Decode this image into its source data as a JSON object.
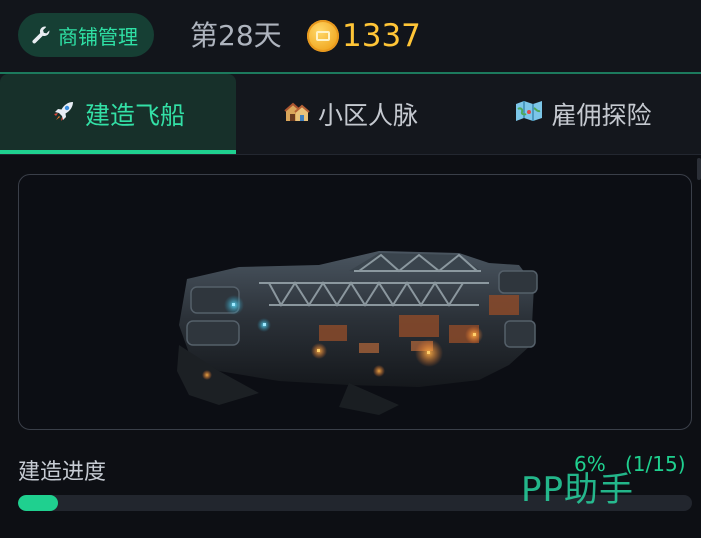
{
  "header": {
    "shop_button_label": "商铺管理",
    "day_label": "第28天",
    "coins": "1337",
    "accent_color": "#1fd08f",
    "coin_color": "#ffc537"
  },
  "tabs": [
    {
      "label": "建造飞船",
      "icon": "rocket-icon",
      "active": true
    },
    {
      "label": "小区人脉",
      "icon": "houses-icon",
      "active": false
    },
    {
      "label": "雇佣探险",
      "icon": "map-icon",
      "active": false
    }
  ],
  "build": {
    "progress_label": "建造进度",
    "progress_percent_text": "6%",
    "progress_count_text": "(1/15)",
    "progress_fraction": 0.06
  },
  "watermark": "PP助手"
}
